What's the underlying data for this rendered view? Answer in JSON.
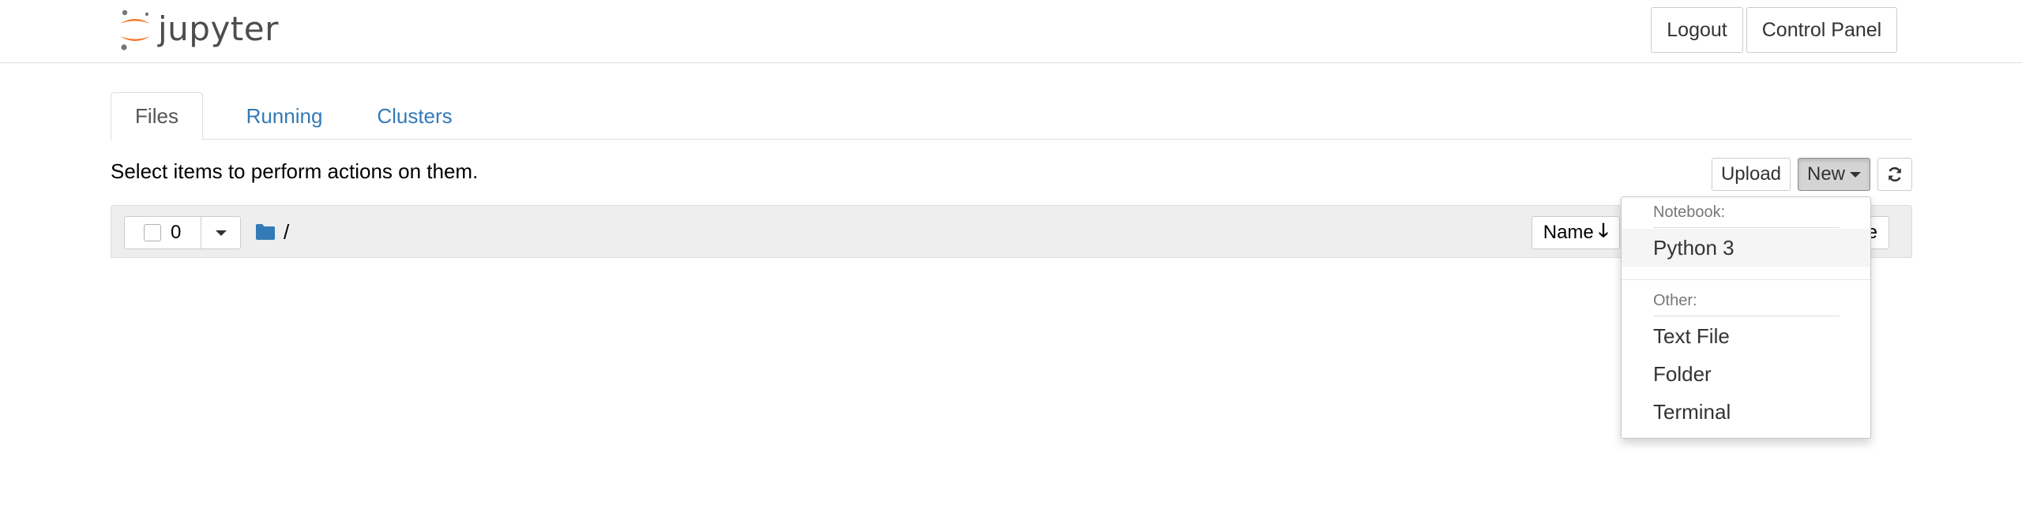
{
  "header": {
    "logo_text": "jupyter",
    "logout_label": "Logout",
    "control_panel_label": "Control Panel"
  },
  "tabs": [
    {
      "label": "Files",
      "active": true
    },
    {
      "label": "Running",
      "active": false
    },
    {
      "label": "Clusters",
      "active": false
    }
  ],
  "toolbar": {
    "instructions": "Select items to perform actions on them.",
    "upload_label": "Upload",
    "new_label": "New",
    "refresh_icon": "refresh-icon"
  },
  "file_list": {
    "selected_count": "0",
    "path_icon": "folder-icon",
    "path": "/",
    "sort_name_label": "Name",
    "sort_name_icon": "arrow-down-icon",
    "sort_size_label_visible": "ze"
  },
  "new_menu": {
    "notebook_header": "Notebook:",
    "notebook_items": [
      "Python 3"
    ],
    "other_header": "Other:",
    "other_items": [
      "Text File",
      "Folder",
      "Terminal"
    ]
  },
  "colors": {
    "link_blue": "#337ab7",
    "logo_orange": "#f37726",
    "logo_gray": "#767677",
    "folder_blue": "#337ab7"
  }
}
